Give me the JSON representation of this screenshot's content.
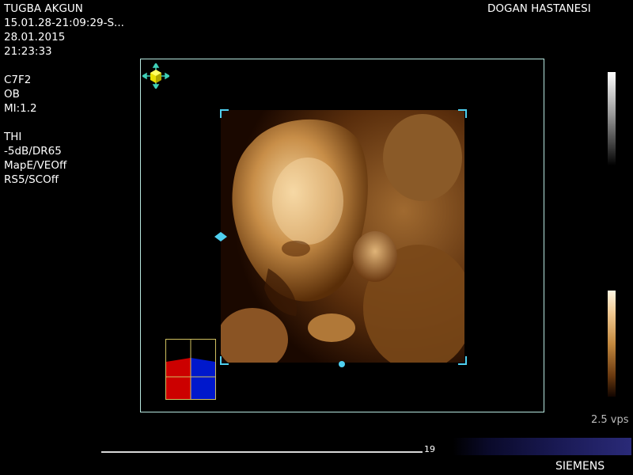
{
  "patient": {
    "name": "TUGBA AKGUN",
    "exam_id": "15.01.28-21:09:29-S...",
    "date": "28.01.2015",
    "time": "21:23:33"
  },
  "hospital": "DOGAN HASTANESI",
  "probe": {
    "transducer": "C7F2",
    "preset": "OB",
    "mi": "MI:1.2"
  },
  "imaging": {
    "mode": "THI",
    "gain_dr": "-5dB/DR65",
    "map": "MapE/VEOff",
    "rs": "RS5/SCOff"
  },
  "volume_rate": "2.5 vps",
  "cine_frame": "19",
  "brand": "SIEMENS",
  "colors": {
    "frame_border": "#b8e8e0",
    "marker_cyan": "#4fd0f0",
    "render_tone": "#c48a40",
    "orient_red": "#cc0000",
    "orient_blue": "#0018cc"
  },
  "icons": {
    "orientation_cube": "orientation-cube-icon",
    "left_marker": "left-diamond-marker-icon",
    "bottom_marker": "bottom-dot-marker-icon"
  }
}
